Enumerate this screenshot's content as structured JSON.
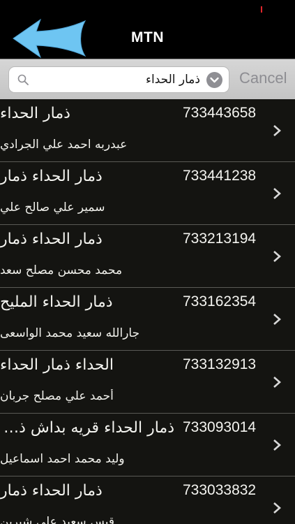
{
  "header": {
    "title": "MTN",
    "back_icon": "back-arrow-icon",
    "back_color": "#6ec5f2"
  },
  "search": {
    "value": "ذمار الحداء",
    "placeholder": "",
    "cancel_label": "Cancel"
  },
  "results": [
    {
      "name": "ذمار الحداء",
      "number": "733443658",
      "person": "عبدربه احمد علي الجرادي"
    },
    {
      "name": "ذمار الحداء ذمار",
      "number": "733441238",
      "person": "سمير علي صالح علي"
    },
    {
      "name": "ذمار الحداء ذمار",
      "number": "733213194",
      "person": "محمد محسن مصلح سعد"
    },
    {
      "name": "ذمار الحداء المليح",
      "number": "733162354",
      "person": "جارالله سعيد محمد الواسعى"
    },
    {
      "name": "الحداء ذمار الحداء",
      "number": "733132913",
      "person": "أحمد علي مصلح جربان"
    },
    {
      "name": "ذمار الحداء قريه بداش ذمار",
      "number": "733093014",
      "person": "وليد محمد احمد اسماعيل"
    },
    {
      "name": "ذمار الحداء ذمار",
      "number": "733033832",
      "person": "قيس سعيد علي شيرين"
    }
  ]
}
